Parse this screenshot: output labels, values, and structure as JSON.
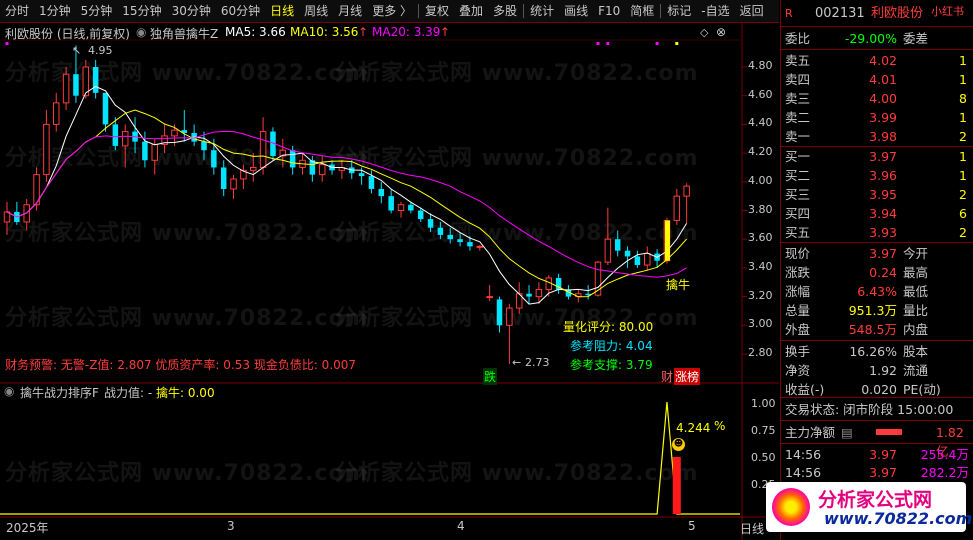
{
  "toolbar": {
    "items": [
      "分时",
      "1分钟",
      "5分钟",
      "15分钟",
      "30分钟",
      "60分钟",
      "日线",
      "周线",
      "月线",
      "更多 〉",
      "复权",
      "叠加",
      "多股",
      "统计",
      "画线",
      "F10",
      "简框",
      "标记",
      "-自选",
      "返回"
    ],
    "active": "日线"
  },
  "chart_header": {
    "stock_label": "利欧股份 (日线,前复权)",
    "indicator": "独角兽擒牛Z",
    "ma5": "MA5: 3.66",
    "ma10": "MA10: 3.56",
    "ma20": "MA20: 3.39",
    "up_arrow": "↑",
    "ma_colors": {
      "ma5": "#ffffff",
      "ma10": "#ffff00",
      "ma20": "#ff00ff"
    }
  },
  "price_axis": [
    "4.80",
    "4.60",
    "4.40",
    "4.20",
    "4.00",
    "3.80",
    "3.60",
    "3.40",
    "3.20",
    "3.00",
    "2.80"
  ],
  "annotations": {
    "high_label": "4.95",
    "low_label": "2.73",
    "buy_label": "擒牛",
    "die_label": "跌",
    "fin_label": "财",
    "rank_label": "涨榜",
    "score": "量化评分: 80.00",
    "resistance": "参考阻力: 4.04",
    "support": "参考支撑: 3.79"
  },
  "finance_line": "财务预警: 无警-Z值: 2.807 优质资产率: 0.53 现金负债比: 0.007",
  "sub_chart": {
    "title": "擒牛战力排序F",
    "power": "战力值: -",
    "qiniu": "擒牛: 0.00",
    "axis": [
      "1.00",
      "0.75",
      "0.50",
      "0.25"
    ],
    "peak_value": "4.244",
    "pct": "%"
  },
  "time_axis": [
    "2025年",
    "3",
    "4",
    "5"
  ],
  "period_label": "日线",
  "panel": {
    "code": "002131",
    "name": "利欧股份",
    "brand": "小红书",
    "weibi_label": "委比",
    "weibi_value": "-29.00%",
    "weicha_label": "委差",
    "asks": [
      {
        "label": "卖五",
        "price": "4.02",
        "vol": "1"
      },
      {
        "label": "卖四",
        "price": "4.01",
        "vol": "1"
      },
      {
        "label": "卖三",
        "price": "4.00",
        "vol": "8"
      },
      {
        "label": "卖二",
        "price": "3.99",
        "vol": "1"
      },
      {
        "label": "卖一",
        "price": "3.98",
        "vol": "2"
      }
    ],
    "bids": [
      {
        "label": "买一",
        "price": "3.97",
        "vol": "1"
      },
      {
        "label": "买二",
        "price": "3.96",
        "vol": "1"
      },
      {
        "label": "买三",
        "price": "3.95",
        "vol": "2"
      },
      {
        "label": "买四",
        "price": "3.94",
        "vol": "6"
      },
      {
        "label": "买五",
        "price": "3.93",
        "vol": "2"
      }
    ],
    "stats": [
      {
        "l1": "现价",
        "v1": "3.97",
        "l2": "今开",
        "c1": "#ff3b3b"
      },
      {
        "l1": "涨跌",
        "v1": "0.24",
        "l2": "最高",
        "c1": "#ff3b3b"
      },
      {
        "l1": "涨幅",
        "v1": "6.43%",
        "l2": "最低",
        "c1": "#ff3b3b"
      },
      {
        "l1": "总量",
        "v1": "951.3万",
        "l2": "量比",
        "c1": "#ffff00"
      },
      {
        "l1": "外盘",
        "v1": "548.5万",
        "l2": "内盘",
        "c1": "#ff3b3b"
      }
    ],
    "stats2": [
      {
        "l1": "换手",
        "v1": "16.26%",
        "l2": "股本"
      },
      {
        "l1": "净资",
        "v1": "1.92",
        "l2": "流通"
      },
      {
        "l1": "收益(-)",
        "v1": "0.020",
        "l2": "PE(动)"
      }
    ],
    "trade_status": "交易状态: 闭市阶段 15:00:00",
    "main_flow_label": "主力净额",
    "main_flow_value": "1.82亿",
    "ticks": [
      {
        "time": "14:56",
        "price": "3.97",
        "vol": "255.4万"
      },
      {
        "time": "14:56",
        "price": "3.97",
        "vol": "282.2万"
      }
    ]
  },
  "watermark": "分析家公式网 www.70822.com",
  "logo": {
    "text": "分析家公式网",
    "url": "www.70822.com"
  },
  "colors": {
    "up": "#ff3b3b",
    "down": "#00e5ff",
    "panel_border": "#7a0000",
    "yellow": "#ffff00"
  }
}
